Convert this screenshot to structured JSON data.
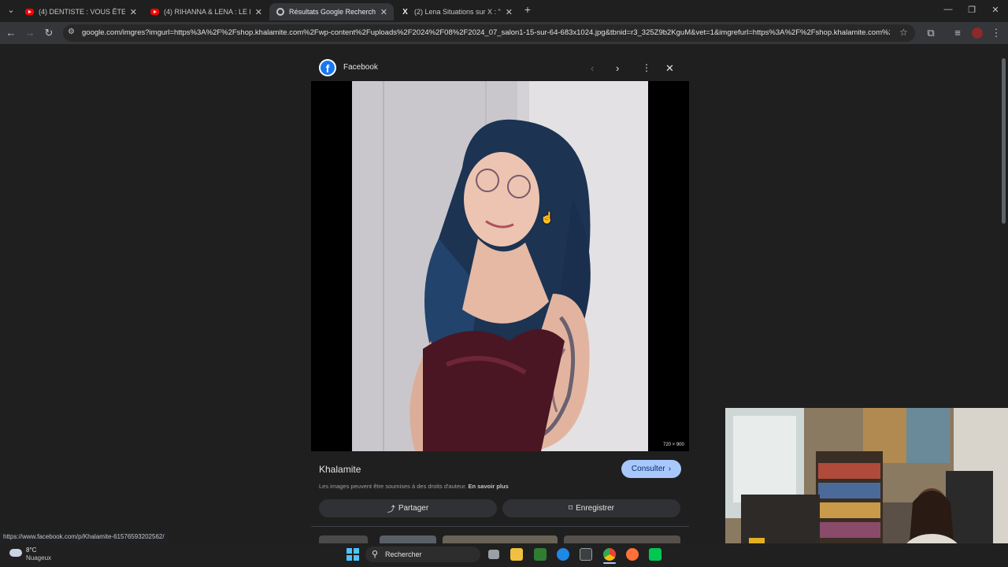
{
  "tabs": [
    {
      "title": "(4) DENTISTE : VOUS ÊTES SALE",
      "favicon": "youtube-icon"
    },
    {
      "title": "(4) RIHANNA & LENA : LE POUV",
      "favicon": "youtube-icon"
    },
    {
      "title": "Résultats Google Recherche d'i",
      "favicon": "google-icon",
      "active": true
    },
    {
      "title": "(2) Lena Situations sur X : \"Osca",
      "favicon": "x-icon"
    }
  ],
  "address": {
    "url": "google.com/imgres?imgurl=https%3A%2F%2Fshop.khalamite.com%2Fwp-content%2Fuploads%2F2024%2F08%2F2024_07_salon1-15-sur-64-683x1024.jpg&tbnid=r3_325Z9b2KguM&vet=1&imgrefurl=https%3A%2F%2Fshop.khalamite.com%2Fabo..."
  },
  "viewer": {
    "source": "Facebook",
    "dimensions": "720 × 900",
    "title": "Khalamite",
    "visit_label": "Consulter",
    "copyright": "Les images peuvent être soumises à des droits d'auteur.",
    "learn_more": "En savoir plus",
    "share_label": "Partager",
    "save_label": "Enregistrer"
  },
  "status_url": "https://www.facebook.com/p/Khalamite-61576593202562/",
  "taskbar": {
    "temp": "8°C",
    "weather": "Nuageux",
    "search_placeholder": "Rechercher"
  },
  "colors": {
    "accent": "#a8c7fa",
    "bg": "#1f1f1f",
    "facebook": "#1877f2"
  }
}
